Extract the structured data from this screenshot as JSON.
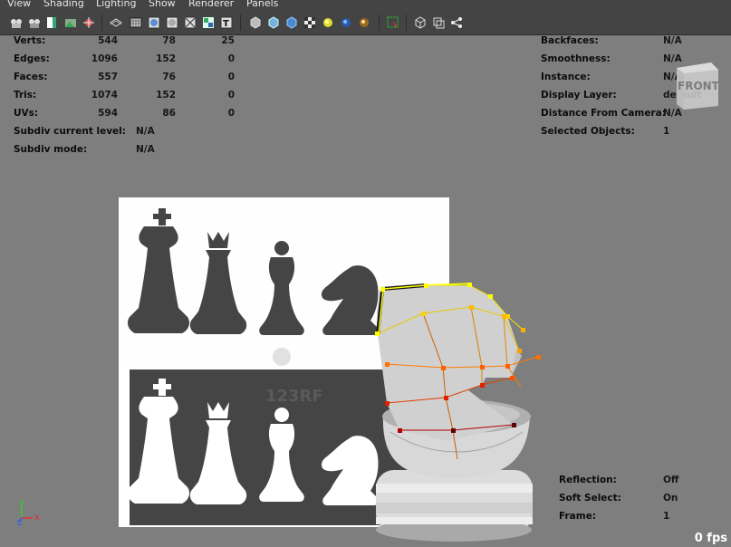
{
  "menu": [
    "View",
    "Shading",
    "Lighting",
    "Show",
    "Renderer",
    "Panels"
  ],
  "toolbar_icons": [
    "camera-select-icon",
    "camera-lock-icon",
    "bookmark-icon",
    "image-plane-icon",
    "grid-toggle-icon",
    "wireframe-icon",
    "wireframe-on-shaded-icon",
    "smooth-shade-icon",
    "flat-shade-icon",
    "bounding-box-icon",
    "texture-icon",
    "xray-icon",
    "default-material-icon",
    "use-lights-icon",
    "shadow-icon",
    "isolate-select-icon",
    "highlight-icon",
    "resolution-gate-icon",
    "film-gate-icon",
    "grease-pencil-icon",
    "ambient-occlusion-icon",
    "anti-alias-icon",
    "depth-of-field-icon",
    "motion-blur-icon",
    "camera-attributes-icon",
    "field-chart-icon",
    "safe-action-icon",
    "share-icon"
  ],
  "hud_left": [
    {
      "label": "Verts:",
      "values": [
        "544",
        "78",
        "25"
      ]
    },
    {
      "label": "Edges:",
      "values": [
        "1096",
        "152",
        "0"
      ]
    },
    {
      "label": "Faces:",
      "values": [
        "557",
        "76",
        "0"
      ]
    },
    {
      "label": "Tris:",
      "values": [
        "1074",
        "152",
        "0"
      ]
    },
    {
      "label": "UVs:",
      "values": [
        "594",
        "86",
        "0"
      ]
    }
  ],
  "hud_subdiv": [
    {
      "label": "Subdiv current level:",
      "value": "N/A"
    },
    {
      "label": "Subdiv mode:",
      "value": "N/A"
    }
  ],
  "hud_right": [
    {
      "label": "Backfaces:",
      "value": "N/A"
    },
    {
      "label": "Smoothness:",
      "value": "N/A"
    },
    {
      "label": "Instance:",
      "value": "N/A"
    },
    {
      "label": "Display Layer:",
      "value": "default"
    },
    {
      "label": "Distance From Camera:",
      "value": "N/A"
    },
    {
      "label": "Selected Objects:",
      "value": "1"
    }
  ],
  "hud_bottom": [
    {
      "label": "Reflection:",
      "value": "Off"
    },
    {
      "label": "Soft Select:",
      "value": "On"
    },
    {
      "label": "Frame:",
      "value": "1"
    }
  ],
  "view_cube_label": "FRONT",
  "fps": "0 fps",
  "axis": {
    "y": "y",
    "z": "z",
    "x": "x"
  },
  "watermark": "123RF",
  "colors": {
    "menubar": "#444444",
    "viewport": "#7e7e7e",
    "selection": "#ffff00"
  }
}
